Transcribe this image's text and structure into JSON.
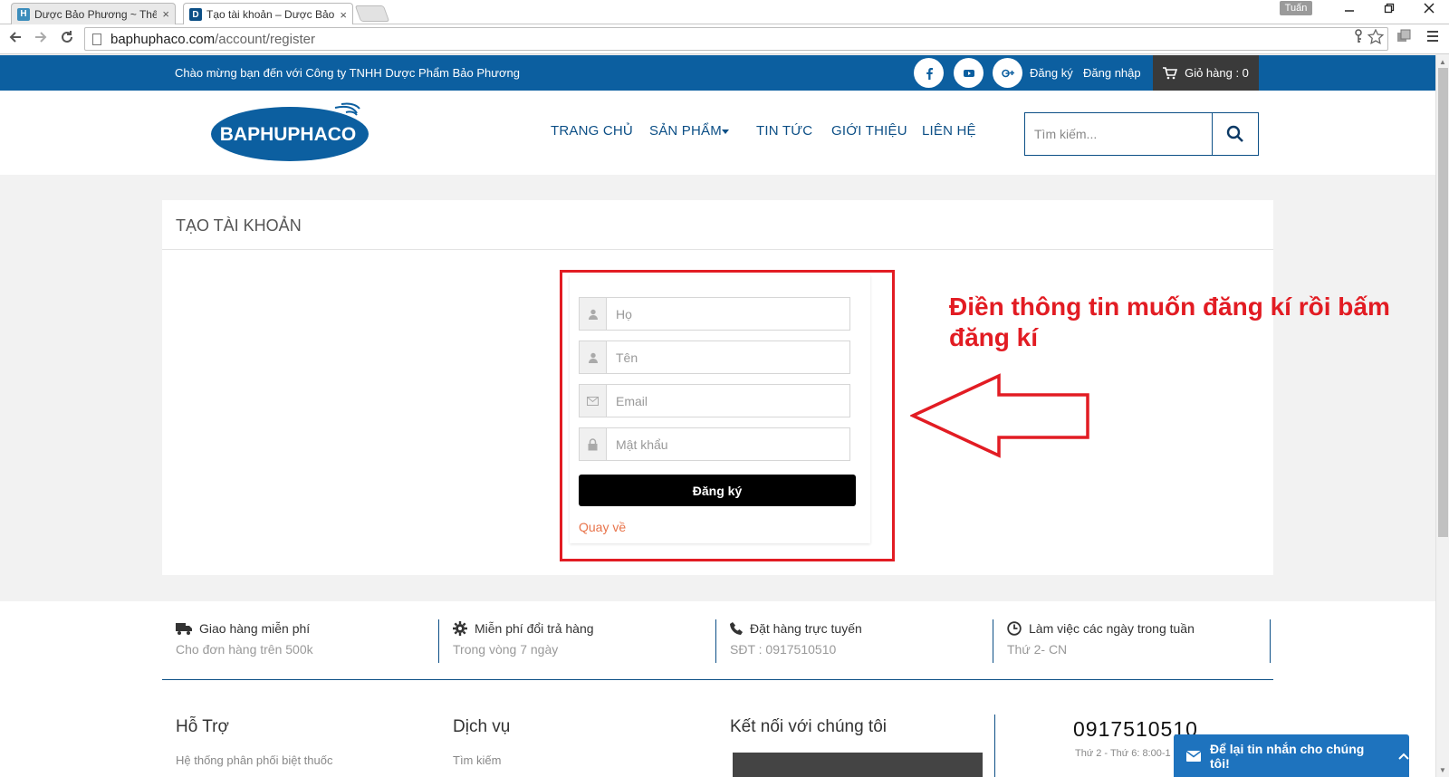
{
  "browser": {
    "tabs": [
      {
        "icon_letter": "H",
        "title": "Dược Bảo Phương ~ Thêm"
      },
      {
        "icon_letter": "D",
        "title": "Tạo tài khoản – Dược Bảo"
      }
    ],
    "tab_close": "×",
    "profile_name": "Tuấn",
    "url_domain": "baphuphaco.com",
    "url_path": "/account/register"
  },
  "topbar": {
    "welcome": "Chào mừng bạn đến với Công ty TNHH Dược Phẩm Bảo Phương",
    "register_link": "Đăng ký",
    "login_link": "Đăng nhập",
    "cart_label": "Giỏ hàng : 0"
  },
  "header": {
    "logo_text": "BAPHUPHACO",
    "nav": [
      "TRANG CHỦ",
      "SẢN PHẨM",
      "TIN TỨC",
      "GIỚI THIỆU",
      "LIÊN HỆ"
    ],
    "search_placeholder": "Tìm kiếm..."
  },
  "register": {
    "title": "TẠO TÀI KHOẢN",
    "fields": [
      {
        "placeholder": "Họ",
        "icon": "user-icon"
      },
      {
        "placeholder": "Tên",
        "icon": "user-icon"
      },
      {
        "placeholder": "Email",
        "icon": "envelope-icon"
      },
      {
        "placeholder": "Mật khẩu",
        "icon": "lock-icon"
      }
    ],
    "submit_label": "Đăng ký",
    "back_link": "Quay về"
  },
  "annotation": {
    "text": "Điền thông tin muốn đăng kí rồi bấm đăng kí",
    "color": "#e21c23"
  },
  "features": [
    {
      "icon": "truck-icon",
      "title": "Giao hàng miễn phí",
      "subtitle": "Cho đơn hàng trên 500k"
    },
    {
      "icon": "gear-icon",
      "title": "Miễn phí đổi trả hàng",
      "subtitle": "Trong vòng 7 ngày"
    },
    {
      "icon": "phone-icon",
      "title": "Đặt hàng trực tuyến",
      "subtitle": "SĐT : 0917510510"
    },
    {
      "icon": "clock-icon",
      "title": "Làm việc các ngày trong tuần",
      "subtitle": "Thứ 2- CN"
    }
  ],
  "footer": {
    "support_title": "Hỗ Trợ",
    "support_first": "Hệ thống phân phối biệt thuốc",
    "services_title": "Dịch vụ",
    "services_first": "Tìm kiếm",
    "connect_title": "Kết nối với chúng tôi",
    "phone": "0917510510",
    "hours": "Thứ 2 - Thứ 6: 8:00-1"
  },
  "chat": {
    "label": "Để lại tin nhắn cho chúng tôi!"
  },
  "colors": {
    "brand_blue": "#0c5fa0",
    "nav_blue": "#0c4f86",
    "accent_orange": "#e8734a",
    "chat_blue": "#1e73be"
  }
}
